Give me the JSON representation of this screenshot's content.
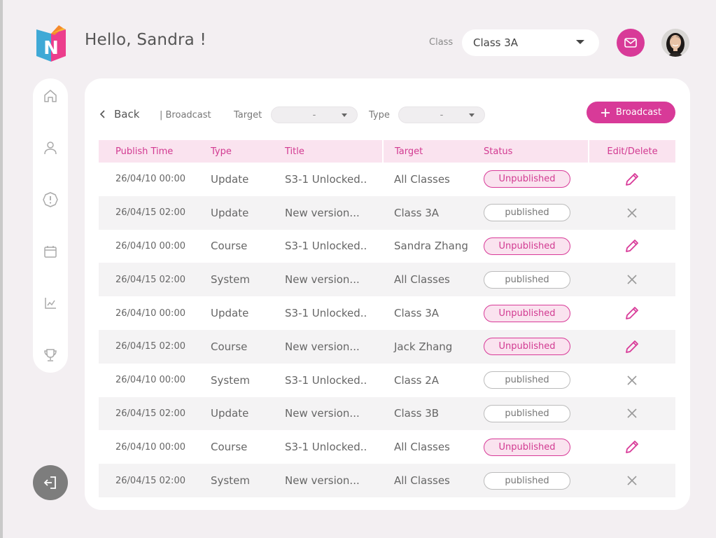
{
  "header": {
    "greeting": "Hello, Sandra !",
    "class_label": "Class",
    "class_value": "Class 3A",
    "mail_icon": "mail-icon",
    "accent_color": "#d83a98"
  },
  "sidebar": {
    "items": [
      {
        "name": "home",
        "icon": "home-icon"
      },
      {
        "name": "profile",
        "icon": "user-icon"
      },
      {
        "name": "alerts",
        "icon": "alert-icon"
      },
      {
        "name": "calendar",
        "icon": "calendar-icon"
      },
      {
        "name": "analytics",
        "icon": "chart-icon"
      },
      {
        "name": "achievements",
        "icon": "trophy-icon"
      }
    ],
    "logout_icon": "logout-icon"
  },
  "toolbar": {
    "back_label": "Back",
    "breadcrumb": "| Broadcast",
    "target_label": "Target",
    "target_value": "-",
    "type_label": "Type",
    "type_value": "-",
    "broadcast_label": "Broadcast"
  },
  "table": {
    "headers": [
      "Publish Time",
      "Type",
      "Title",
      "Target",
      "Status",
      "Edit/Delete"
    ],
    "rows": [
      {
        "time": "26/04/10 00:00",
        "type": "Update",
        "title": "S3-1 Unlocked..",
        "target": "All Classes",
        "status": "Unpublished",
        "action": "edit"
      },
      {
        "time": "26/04/15 02:00",
        "type": "Update",
        "title": "New version...",
        "target": "Class 3A",
        "status": "published",
        "action": "delete"
      },
      {
        "time": "26/04/10 00:00",
        "type": "Course",
        "title": "S3-1 Unlocked..",
        "target": "Sandra Zhang",
        "status": "Unpublished",
        "action": "edit"
      },
      {
        "time": "26/04/15 02:00",
        "type": "System",
        "title": "New version...",
        "target": "All Classes",
        "status": "published",
        "action": "delete"
      },
      {
        "time": "26/04/10 00:00",
        "type": "Update",
        "title": "S3-1 Unlocked..",
        "target": "Class 3A",
        "status": "Unpublished",
        "action": "edit"
      },
      {
        "time": "26/04/15 02:00",
        "type": "Course",
        "title": "New version...",
        "target": "Jack Zhang",
        "status": "Unpublished",
        "action": "edit"
      },
      {
        "time": "26/04/10 00:00",
        "type": "System",
        "title": "S3-1 Unlocked..",
        "target": "Class 2A",
        "status": "published",
        "action": "delete"
      },
      {
        "time": "26/04/15 02:00",
        "type": "Update",
        "title": "New version...",
        "target": "Class 3B",
        "status": "published",
        "action": "delete"
      },
      {
        "time": "26/04/10 00:00",
        "type": "Course",
        "title": "S3-1 Unlocked..",
        "target": "All Classes",
        "status": "Unpublished",
        "action": "edit"
      },
      {
        "time": "26/04/15 02:00",
        "type": "System",
        "title": "New version...",
        "target": "All Classes",
        "status": "published",
        "action": "delete"
      }
    ]
  }
}
